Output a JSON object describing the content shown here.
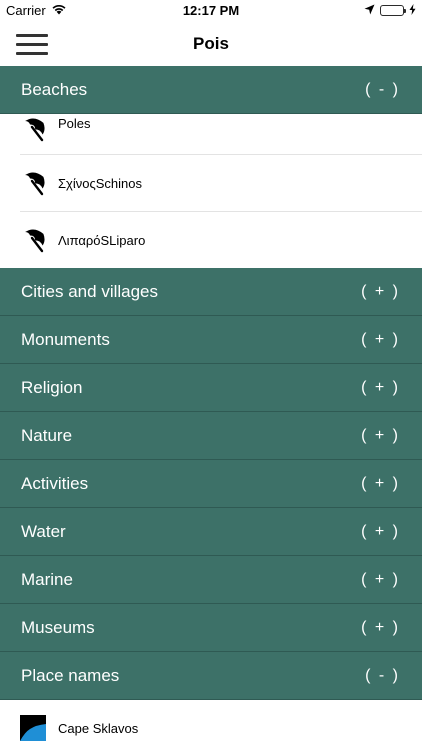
{
  "status_bar": {
    "carrier": "Carrier",
    "time": "12:17 PM"
  },
  "nav": {
    "title": "Pois"
  },
  "sections": [
    {
      "label": "Beaches",
      "toggle": "( - )",
      "items": [
        {
          "label": "Poles",
          "icon": "umbrella-icon"
        },
        {
          "label": "ΣχίνοςSchinos",
          "icon": "umbrella-icon"
        },
        {
          "label": "ΛιπαρόSLiparo",
          "icon": "umbrella-icon"
        }
      ]
    },
    {
      "label": "Cities and villages",
      "toggle": "( + )"
    },
    {
      "label": "Monuments",
      "toggle": "( + )"
    },
    {
      "label": "Religion",
      "toggle": "( + )"
    },
    {
      "label": "Nature",
      "toggle": "( + )"
    },
    {
      "label": "Activities",
      "toggle": "( + )"
    },
    {
      "label": "Water",
      "toggle": "( + )"
    },
    {
      "label": "Marine",
      "toggle": "( + )"
    },
    {
      "label": "Museums",
      "toggle": "( + )"
    },
    {
      "label": "Place names",
      "toggle": "( - )",
      "items": [
        {
          "label": "Cape Sklavos",
          "icon": "cape-icon"
        }
      ]
    }
  ],
  "colors": {
    "section_bg": "#3d7168",
    "battery": "#4cd964"
  }
}
